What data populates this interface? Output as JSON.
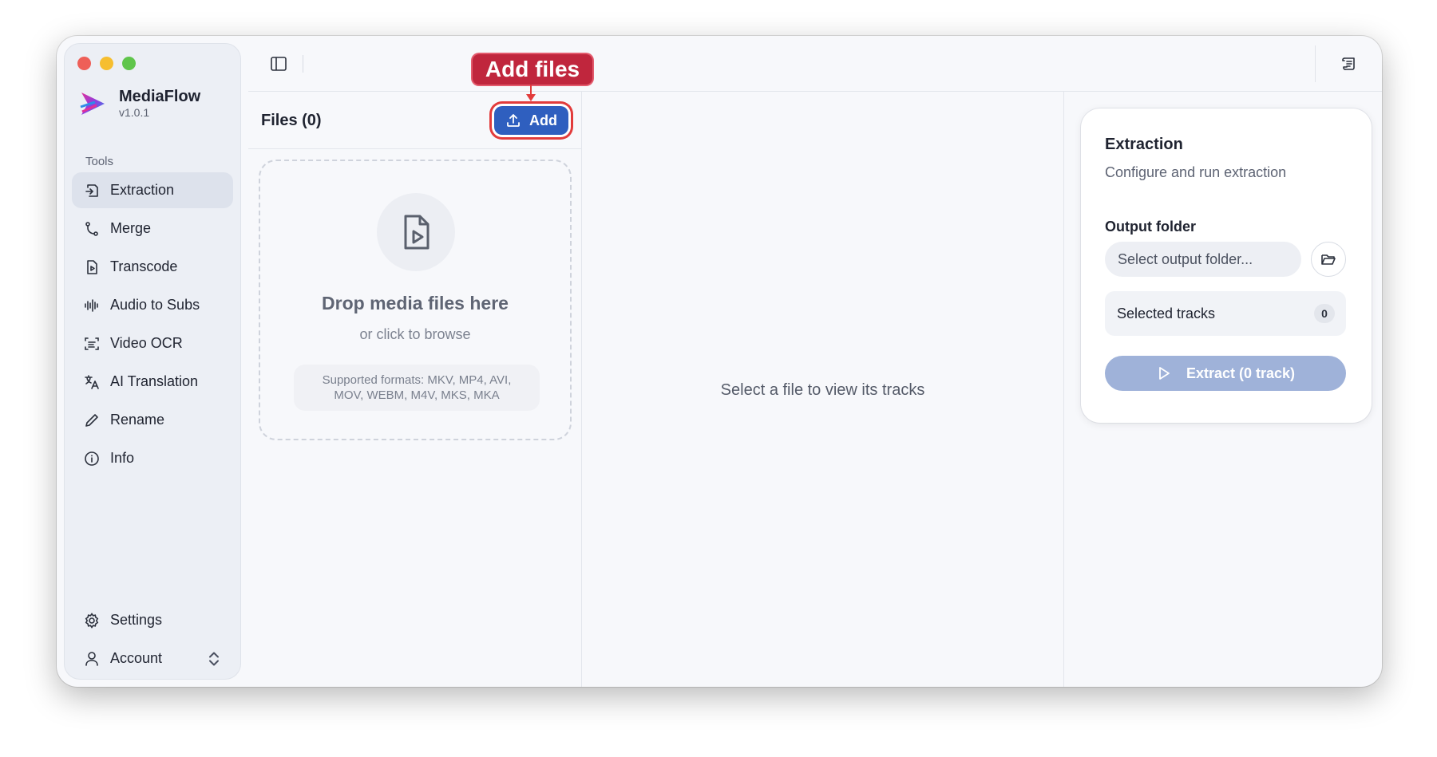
{
  "app": {
    "name": "MediaFlow",
    "version": "v1.0.1"
  },
  "sidebar": {
    "section_label": "Tools",
    "items": [
      {
        "label": "Extraction",
        "icon": "extraction-icon",
        "active": true
      },
      {
        "label": "Merge",
        "icon": "merge-icon"
      },
      {
        "label": "Transcode",
        "icon": "transcode-icon"
      },
      {
        "label": "Audio to Subs",
        "icon": "audio-wave-icon"
      },
      {
        "label": "Video OCR",
        "icon": "scan-text-icon"
      },
      {
        "label": "AI Translation",
        "icon": "translate-icon"
      },
      {
        "label": "Rename",
        "icon": "pencil-icon"
      },
      {
        "label": "Info",
        "icon": "info-icon"
      }
    ],
    "settings_label": "Settings",
    "account_label": "Account"
  },
  "files": {
    "title": "Files (0)",
    "add_label": "Add",
    "drop_title": "Drop media files here",
    "drop_sub": "or click to browse",
    "formats_line1": "Supported formats: MKV, MP4, AVI,",
    "formats_line2": "MOV, WEBM, M4V, MKS, MKA"
  },
  "tracks": {
    "empty_text": "Select a file to view its tracks"
  },
  "panel": {
    "title": "Extraction",
    "subtitle": "Configure and run extraction",
    "output_label": "Output folder",
    "output_placeholder": "Select output folder...",
    "selected_tracks_label": "Selected tracks",
    "selected_tracks_count": "0",
    "extract_label": "Extract (0 track)"
  },
  "annotation": {
    "label": "Add files"
  },
  "colors": {
    "accent": "#2f5fbf",
    "extract_disabled": "#9fb2d9",
    "callout": "#c0263d",
    "highlight_outline": "#e23b3b"
  }
}
